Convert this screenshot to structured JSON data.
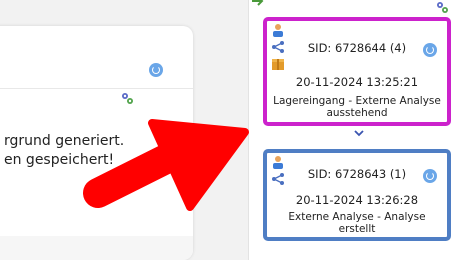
{
  "panel": {
    "line1": "rgrund generiert.",
    "line2": "en gespeichert!"
  },
  "cards": [
    {
      "sid": "SID: 6728644 (4)",
      "datetime": "20-11-2024 13:25:21",
      "status_line1": "Lagereingang - Externe Analyse",
      "status_line2": "ausstehend",
      "border_color": "#cc22cc"
    },
    {
      "sid": "SID: 6728643 (1)",
      "datetime": "20-11-2024 13:26:28",
      "status_line1": "Externe Analyse - Analyse",
      "status_line2": "erstellt",
      "border_color": "#4f7ec4"
    }
  ],
  "colors": {
    "arrow": "#ff0000",
    "accent_blue": "#6aa6e8",
    "highlight_magenta": "#cc22cc"
  },
  "icons": {
    "panel": [
      "gears-icon",
      "refresh-icon"
    ],
    "card": [
      "person-icon",
      "share-icon",
      "box-icon",
      "refresh-icon"
    ],
    "sidebar_top": [
      "arrow-right-icon",
      "gears-icon"
    ]
  }
}
